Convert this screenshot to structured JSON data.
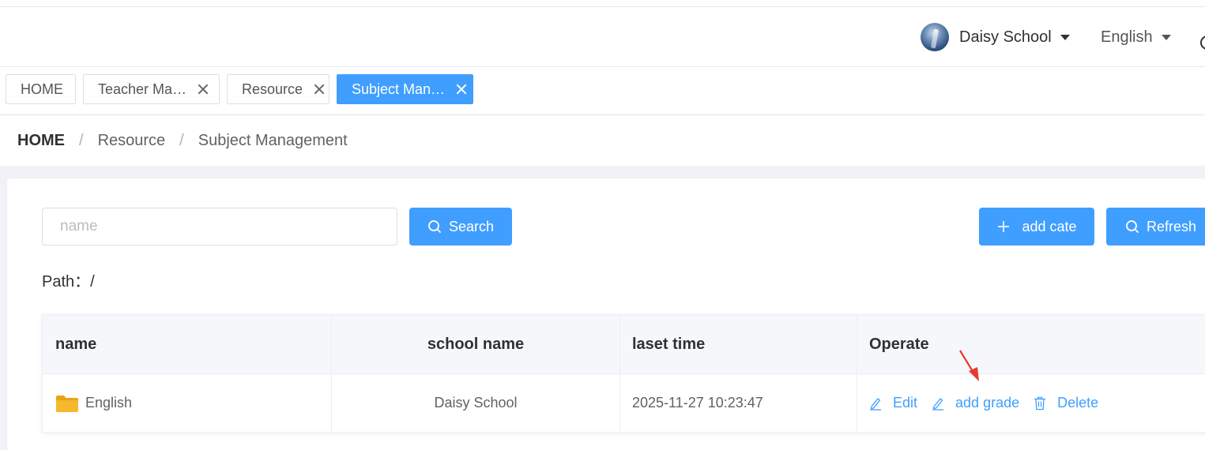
{
  "header": {
    "user_name": "Daisy School",
    "language": "English"
  },
  "tabs": [
    {
      "label": "HOME",
      "closable": false,
      "active": false
    },
    {
      "label": "Teacher Ma…",
      "closable": true,
      "active": false
    },
    {
      "label": "Resource",
      "closable": true,
      "active": false
    },
    {
      "label": "Subject Man…",
      "closable": true,
      "active": true
    }
  ],
  "breadcrumb": {
    "home": "HOME",
    "items": [
      "Resource",
      "Subject Management"
    ]
  },
  "toolbar": {
    "search_placeholder": "name",
    "search_value": "",
    "search_label": "Search",
    "add_label": "add cate",
    "refresh_label": "Refresh"
  },
  "path": {
    "label": "Path：",
    "value": "/"
  },
  "table": {
    "columns": [
      "name",
      "school name",
      "laset time",
      "Operate"
    ],
    "rows": [
      {
        "name": "English",
        "school_name": "Daisy School",
        "last_time": "2025-11-27 10:23:47",
        "actions": [
          "Edit",
          "add grade",
          "Delete"
        ]
      }
    ]
  },
  "colors": {
    "primary": "#409eff",
    "annotation_arrow": "#e8392e"
  }
}
